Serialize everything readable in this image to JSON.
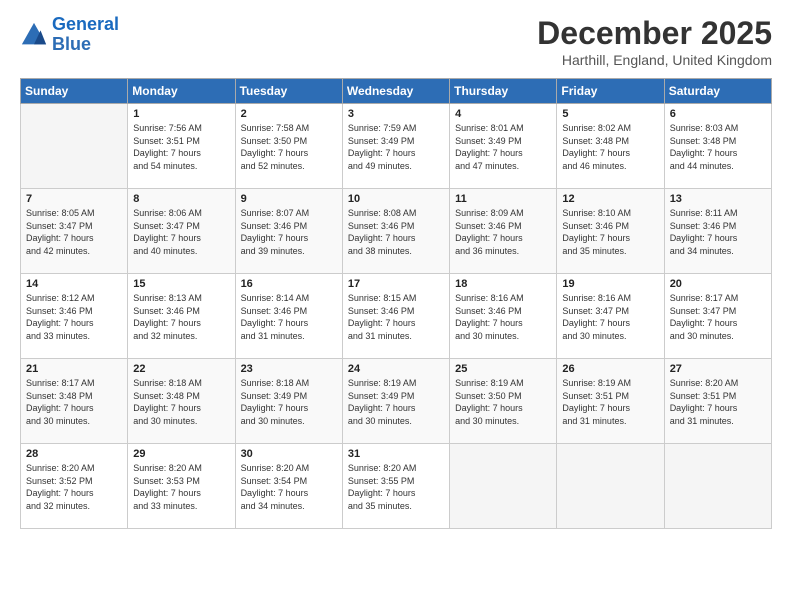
{
  "logo": {
    "line1": "General",
    "line2": "Blue"
  },
  "title": "December 2025",
  "location": "Harthill, England, United Kingdom",
  "days_of_week": [
    "Sunday",
    "Monday",
    "Tuesday",
    "Wednesday",
    "Thursday",
    "Friday",
    "Saturday"
  ],
  "weeks": [
    [
      {
        "day": "",
        "sunrise": "",
        "sunset": "",
        "daylight": ""
      },
      {
        "day": "1",
        "sunrise": "Sunrise: 7:56 AM",
        "sunset": "Sunset: 3:51 PM",
        "daylight": "Daylight: 7 hours and 54 minutes."
      },
      {
        "day": "2",
        "sunrise": "Sunrise: 7:58 AM",
        "sunset": "Sunset: 3:50 PM",
        "daylight": "Daylight: 7 hours and 52 minutes."
      },
      {
        "day": "3",
        "sunrise": "Sunrise: 7:59 AM",
        "sunset": "Sunset: 3:49 PM",
        "daylight": "Daylight: 7 hours and 49 minutes."
      },
      {
        "day": "4",
        "sunrise": "Sunrise: 8:01 AM",
        "sunset": "Sunset: 3:49 PM",
        "daylight": "Daylight: 7 hours and 47 minutes."
      },
      {
        "day": "5",
        "sunrise": "Sunrise: 8:02 AM",
        "sunset": "Sunset: 3:48 PM",
        "daylight": "Daylight: 7 hours and 46 minutes."
      },
      {
        "day": "6",
        "sunrise": "Sunrise: 8:03 AM",
        "sunset": "Sunset: 3:48 PM",
        "daylight": "Daylight: 7 hours and 44 minutes."
      }
    ],
    [
      {
        "day": "7",
        "sunrise": "Sunrise: 8:05 AM",
        "sunset": "Sunset: 3:47 PM",
        "daylight": "Daylight: 7 hours and 42 minutes."
      },
      {
        "day": "8",
        "sunrise": "Sunrise: 8:06 AM",
        "sunset": "Sunset: 3:47 PM",
        "daylight": "Daylight: 7 hours and 40 minutes."
      },
      {
        "day": "9",
        "sunrise": "Sunrise: 8:07 AM",
        "sunset": "Sunset: 3:46 PM",
        "daylight": "Daylight: 7 hours and 39 minutes."
      },
      {
        "day": "10",
        "sunrise": "Sunrise: 8:08 AM",
        "sunset": "Sunset: 3:46 PM",
        "daylight": "Daylight: 7 hours and 38 minutes."
      },
      {
        "day": "11",
        "sunrise": "Sunrise: 8:09 AM",
        "sunset": "Sunset: 3:46 PM",
        "daylight": "Daylight: 7 hours and 36 minutes."
      },
      {
        "day": "12",
        "sunrise": "Sunrise: 8:10 AM",
        "sunset": "Sunset: 3:46 PM",
        "daylight": "Daylight: 7 hours and 35 minutes."
      },
      {
        "day": "13",
        "sunrise": "Sunrise: 8:11 AM",
        "sunset": "Sunset: 3:46 PM",
        "daylight": "Daylight: 7 hours and 34 minutes."
      }
    ],
    [
      {
        "day": "14",
        "sunrise": "Sunrise: 8:12 AM",
        "sunset": "Sunset: 3:46 PM",
        "daylight": "Daylight: 7 hours and 33 minutes."
      },
      {
        "day": "15",
        "sunrise": "Sunrise: 8:13 AM",
        "sunset": "Sunset: 3:46 PM",
        "daylight": "Daylight: 7 hours and 32 minutes."
      },
      {
        "day": "16",
        "sunrise": "Sunrise: 8:14 AM",
        "sunset": "Sunset: 3:46 PM",
        "daylight": "Daylight: 7 hours and 31 minutes."
      },
      {
        "day": "17",
        "sunrise": "Sunrise: 8:15 AM",
        "sunset": "Sunset: 3:46 PM",
        "daylight": "Daylight: 7 hours and 31 minutes."
      },
      {
        "day": "18",
        "sunrise": "Sunrise: 8:16 AM",
        "sunset": "Sunset: 3:46 PM",
        "daylight": "Daylight: 7 hours and 30 minutes."
      },
      {
        "day": "19",
        "sunrise": "Sunrise: 8:16 AM",
        "sunset": "Sunset: 3:47 PM",
        "daylight": "Daylight: 7 hours and 30 minutes."
      },
      {
        "day": "20",
        "sunrise": "Sunrise: 8:17 AM",
        "sunset": "Sunset: 3:47 PM",
        "daylight": "Daylight: 7 hours and 30 minutes."
      }
    ],
    [
      {
        "day": "21",
        "sunrise": "Sunrise: 8:17 AM",
        "sunset": "Sunset: 3:48 PM",
        "daylight": "Daylight: 7 hours and 30 minutes."
      },
      {
        "day": "22",
        "sunrise": "Sunrise: 8:18 AM",
        "sunset": "Sunset: 3:48 PM",
        "daylight": "Daylight: 7 hours and 30 minutes."
      },
      {
        "day": "23",
        "sunrise": "Sunrise: 8:18 AM",
        "sunset": "Sunset: 3:49 PM",
        "daylight": "Daylight: 7 hours and 30 minutes."
      },
      {
        "day": "24",
        "sunrise": "Sunrise: 8:19 AM",
        "sunset": "Sunset: 3:49 PM",
        "daylight": "Daylight: 7 hours and 30 minutes."
      },
      {
        "day": "25",
        "sunrise": "Sunrise: 8:19 AM",
        "sunset": "Sunset: 3:50 PM",
        "daylight": "Daylight: 7 hours and 30 minutes."
      },
      {
        "day": "26",
        "sunrise": "Sunrise: 8:19 AM",
        "sunset": "Sunset: 3:51 PM",
        "daylight": "Daylight: 7 hours and 31 minutes."
      },
      {
        "day": "27",
        "sunrise": "Sunrise: 8:20 AM",
        "sunset": "Sunset: 3:51 PM",
        "daylight": "Daylight: 7 hours and 31 minutes."
      }
    ],
    [
      {
        "day": "28",
        "sunrise": "Sunrise: 8:20 AM",
        "sunset": "Sunset: 3:52 PM",
        "daylight": "Daylight: 7 hours and 32 minutes."
      },
      {
        "day": "29",
        "sunrise": "Sunrise: 8:20 AM",
        "sunset": "Sunset: 3:53 PM",
        "daylight": "Daylight: 7 hours and 33 minutes."
      },
      {
        "day": "30",
        "sunrise": "Sunrise: 8:20 AM",
        "sunset": "Sunset: 3:54 PM",
        "daylight": "Daylight: 7 hours and 34 minutes."
      },
      {
        "day": "31",
        "sunrise": "Sunrise: 8:20 AM",
        "sunset": "Sunset: 3:55 PM",
        "daylight": "Daylight: 7 hours and 35 minutes."
      },
      {
        "day": "",
        "sunrise": "",
        "sunset": "",
        "daylight": ""
      },
      {
        "day": "",
        "sunrise": "",
        "sunset": "",
        "daylight": ""
      },
      {
        "day": "",
        "sunrise": "",
        "sunset": "",
        "daylight": ""
      }
    ]
  ]
}
